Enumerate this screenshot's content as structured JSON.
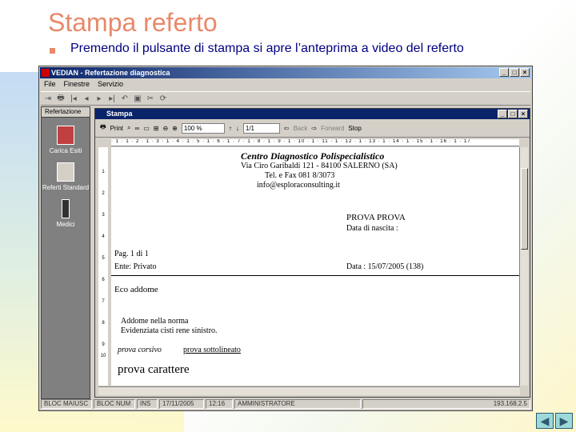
{
  "slide": {
    "title": "Stampa referto",
    "bullet": "Premendo il pulsante di stampa si apre l’anteprima a video del referto"
  },
  "app": {
    "title": "VEDIAN - Refertazione diagnostica",
    "menu": [
      "File",
      "Finestre",
      "Servizio"
    ],
    "sidebar": {
      "header": "Refertazione",
      "items": [
        "Carica  Esiti",
        "Referti Standard",
        "Medici"
      ]
    },
    "statusbar": [
      "BLOC MAIUSC",
      "BLOC NUM",
      "INS",
      "17/11/2005",
      "12:16",
      "AMMINISTRATORE",
      "193.168.2.5"
    ]
  },
  "preview": {
    "title": "Stampa",
    "toolbar": {
      "print_label": "Print",
      "zoom": "100 %",
      "page": "1/1",
      "back_label": "Back",
      "forward_label": "Forward",
      "stop_label": "Stop"
    },
    "ruler": "· 1 · 1 · 2 · 1 · 3 · 1 · 4 · 1 · 5 · 1 · 6 · 1 · 7 · 1 · 8 · 1 · 9 · 1 · 10 · 1 · 11 · 1 · 12 · 1 · 13 · 1 · 14 · 1 · 15 · 1 · 16 · 1 · 17",
    "vruler": [
      "1",
      "2",
      "3",
      "4",
      "5",
      "6",
      "7",
      "8",
      "9",
      "10"
    ],
    "doc": {
      "center_name": "Centro Diagnostico Polispecialistico",
      "address": "Via Ciro Garibaldi 121 - 84100 SALERNO (SA)",
      "tel": "Tel. e Fax 081 8/3073",
      "email": "info@esploraconsulting.it",
      "patient": "PROVA PROVA",
      "birth_label": "Data di nascita :",
      "page_label": "Pag. 1 di",
      "page_total": "1",
      "entity": "Ente: Privato",
      "date": "Data : 15/07/2005 (138)",
      "exam": "Eco addome",
      "line1": "Addome nella norma",
      "line2": "Evidenziata cisti rene sinistro.",
      "italic": "prova corsivo",
      "underline": "prova sottolineato",
      "big": "prova carattere"
    }
  },
  "colors": {
    "title_accent": "#e8896a",
    "bullet_text": "#000080",
    "titlebar": "#0a246a"
  }
}
